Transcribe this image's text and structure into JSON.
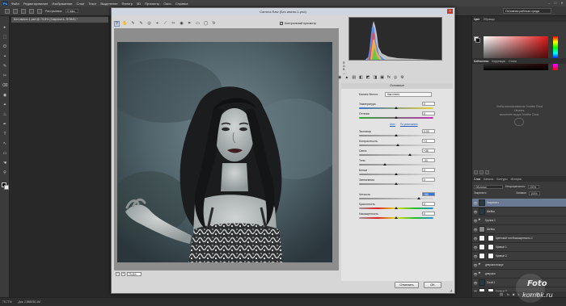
{
  "app": {
    "logo": "Ps",
    "menu": [
      "Файл",
      "Редактирование",
      "Изображение",
      "Слои",
      "Текст",
      "Выделение",
      "Фильтр",
      "3D",
      "Просмотр",
      "Окно",
      "Справка"
    ],
    "window_controls": [
      "–",
      "□",
      "✕"
    ]
  },
  "options_bar": {
    "sample_label": "Растушевка:",
    "sample_value": "0 пикс.",
    "workspace": "Основная рабочая среда"
  },
  "document_tab": "Без имени-1.psd @ 79,8% (Закрепить, RGB/8) *",
  "camera_raw": {
    "title": "Camera Raw (Без имени-1.psd)",
    "close": "✕",
    "preview_label": "Контрольный просмотр",
    "preview_checked": "✓",
    "zoom": "79,8%",
    "zoom_minus": "−",
    "zoom_plus": "+",
    "histogram_readout": [
      "R:",
      "G:",
      "B:",
      "---"
    ],
    "panel_tabs": [
      "◉",
      "▲",
      "▤",
      "◧",
      "◩",
      "◨",
      "▣",
      "fx",
      "◎",
      "⚙"
    ],
    "panel_title": "Основные",
    "white_balance": {
      "label": "Баланс белого:",
      "value": "Как снято"
    },
    "auto_link": "Авто",
    "default_link": "По умолчанию",
    "sliders": [
      {
        "label": "Температура",
        "value": "0",
        "pos": 0.5,
        "kind": "temp"
      },
      {
        "label": "Оттенок",
        "value": "0",
        "pos": 0.5,
        "kind": "tint"
      },
      {
        "label": "Экспонир",
        "value": "0,00",
        "pos": 0.5,
        "kind": "neutral"
      },
      {
        "label": "Контрастность",
        "value": "+3",
        "pos": 0.52,
        "kind": "neutral"
      },
      {
        "label": "Света",
        "value": "+36",
        "pos": 0.68,
        "kind": "neutral"
      },
      {
        "label": "Тени",
        "value": "-31",
        "pos": 0.35,
        "kind": "neutral"
      },
      {
        "label": "Белые",
        "value": "0",
        "pos": 0.5,
        "kind": "neutral"
      },
      {
        "label": "Затемнения",
        "value": "0",
        "pos": 0.5,
        "kind": "neutral"
      },
      {
        "label": "Четкость",
        "value": "+60",
        "pos": 0.8,
        "kind": "neutral",
        "selected": true
      },
      {
        "label": "Красочность",
        "value": "0",
        "pos": 0.5,
        "kind": "sat"
      },
      {
        "label": "Насыщенность",
        "value": "0",
        "pos": 0.5,
        "kind": "sat"
      }
    ],
    "cancel_label": "Отменить",
    "ok_label": "OK"
  },
  "right_panel": {
    "color_tabs": [
      "Цвет",
      "Образцы"
    ],
    "library_tabs": [
      "Библиотеки",
      "Коррекция",
      "Стили"
    ],
    "cc_message_line1": "Чтобы воспользоваться Creative Cloud",
    "cc_message_line2": "Libraries,",
    "cc_message_line3": "выполните вход в Creative Cloud.",
    "layer_tabs": [
      "Слои",
      "Каналы",
      "Контуры",
      "История"
    ],
    "blend_mode": "Обычные",
    "opacity_label": "Непрозрачность:",
    "opacity_value": "100%",
    "lock_label": "Закрепить:",
    "fill_label": "Заливка:",
    "fill_value": "100%",
    "layers": [
      {
        "name": "Закрепить",
        "thumb": "dark",
        "selected": true
      },
      {
        "name": "Шейка",
        "thumb": "dark"
      },
      {
        "name": "Группа 1",
        "thumb": "folder"
      },
      {
        "name": "Шейка",
        "thumb": "gray"
      },
      {
        "name": "Цветовой тон/Насыщенность 2",
        "thumb": "white",
        "mask": true
      },
      {
        "name": "Кривые 1",
        "thumb": "white",
        "mask": true
      },
      {
        "name": "Кривые 2",
        "thumb": "white",
        "mask": true
      },
      {
        "name": "девушка вокруг",
        "thumb": "folder"
      },
      {
        "name": "девушка",
        "thumb": "folder"
      },
      {
        "name": "Слой 1",
        "thumb": "dark"
      },
      {
        "name": "Кривые 3",
        "thumb": "white",
        "mask": true
      }
    ],
    "footer_icons": [
      "⛓",
      "fx",
      "◙",
      "◐",
      "▭",
      "▢",
      "🗑"
    ]
  },
  "status_bar": {
    "zoom": "79,77%",
    "doc_info": "Док: 2,88M/30,1M"
  },
  "watermark": {
    "line1": "Foto",
    "line2": "komok.ru"
  },
  "tools": [
    "▸",
    "⬚",
    "ʘ",
    "⌖",
    "✎",
    "✂",
    "⌫",
    "◉",
    "✦",
    "♨",
    "✒",
    "T",
    "↖",
    "▭",
    "☚",
    "⚲"
  ]
}
